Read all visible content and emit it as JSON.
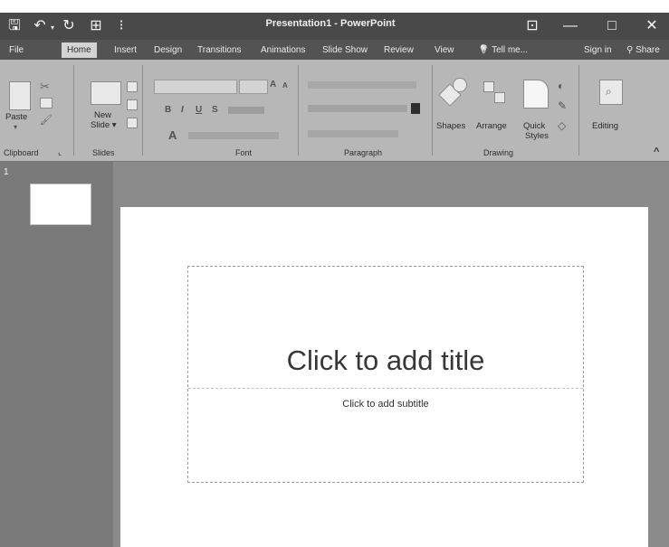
{
  "window": {
    "title": "Presentation1 - PowerPoint",
    "controls": {
      "restore_glyph": "⊡",
      "minimize_glyph": "—",
      "maximize_glyph": "□",
      "close_glyph": "✕"
    }
  },
  "quick_access": {
    "save_glyph": "🖫",
    "undo_glyph": "↶",
    "redo_glyph": "↻",
    "present_glyph": "⊞",
    "customize_glyph": "⁝"
  },
  "tabs": [
    "File",
    "Home",
    "Insert",
    "Design",
    "Transitions",
    "Animations",
    "Slide Show",
    "Review",
    "View"
  ],
  "active_tab": "Home",
  "tell_me": {
    "glyph": "💡",
    "label": "Tell me..."
  },
  "account": {
    "sign_in": "Sign in",
    "share": "Share",
    "share_glyph": "⚲"
  },
  "ribbon": {
    "groups": {
      "clipboard": "Clipboard",
      "clipboard_launcher": "⌞",
      "slides": "Slides",
      "font": "Font",
      "paragraph": "Paragraph",
      "drawing": "Drawing"
    },
    "buttons": {
      "paste": "Paste",
      "new_slide_line1": "New",
      "new_slide_line2": "Slide ▾",
      "bold": "B",
      "italic": "I",
      "underline": "U",
      "strike": "S",
      "font_color": "A",
      "shapes": "Shapes",
      "arrange": "Arrange",
      "quick_styles_line1": "Quick",
      "quick_styles_line2": "Styles",
      "editing": "Editing",
      "collapse": "^"
    }
  },
  "thumbnails": {
    "slide_number": "1"
  },
  "slide": {
    "title_placeholder": "Click to add title",
    "subtitle_placeholder": "Click to add subtitle"
  }
}
